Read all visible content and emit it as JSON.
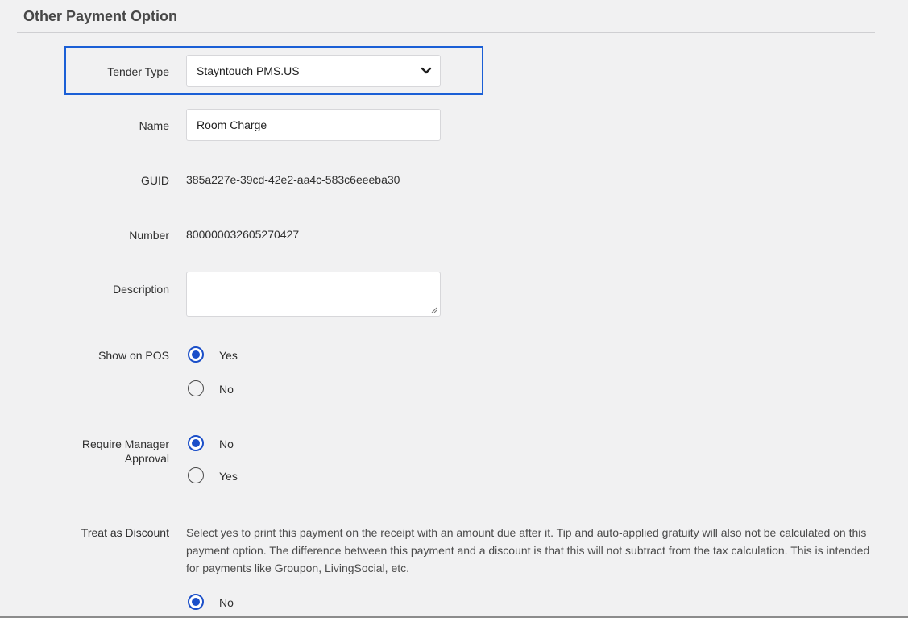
{
  "section": {
    "title": "Other Payment Option"
  },
  "form": {
    "tender_type": {
      "label": "Tender Type",
      "selected": "Stayntouch PMS.US"
    },
    "name": {
      "label": "Name",
      "value": "Room Charge"
    },
    "guid": {
      "label": "GUID",
      "value": "385a227e-39cd-42e2-aa4c-583c6eeeba30"
    },
    "number": {
      "label": "Number",
      "value": "800000032605270427"
    },
    "description": {
      "label": "Description",
      "value": ""
    },
    "show_on_pos": {
      "label": "Show on POS",
      "options": [
        {
          "label": "Yes",
          "selected": true
        },
        {
          "label": "No",
          "selected": false
        }
      ]
    },
    "require_manager_approval": {
      "label_line1": "Require Manager",
      "label_line2": "Approval",
      "options": [
        {
          "label": "No",
          "selected": true
        },
        {
          "label": "Yes",
          "selected": false
        }
      ]
    },
    "treat_as_discount": {
      "label": "Treat as Discount",
      "description": "Select yes to print this payment on the receipt with an amount due after it. Tip and auto-applied gratuity will also not be calculated on this payment option. The difference between this payment and a discount is that this will not subtract from the tax calculation. This is intended for payments like Groupon, LivingSocial, etc.",
      "options": [
        {
          "label": "No",
          "selected": true
        }
      ]
    }
  },
  "colors": {
    "accent": "#1b4fc9",
    "highlight_border": "#1b5fd6",
    "background": "#f1f1f2"
  }
}
